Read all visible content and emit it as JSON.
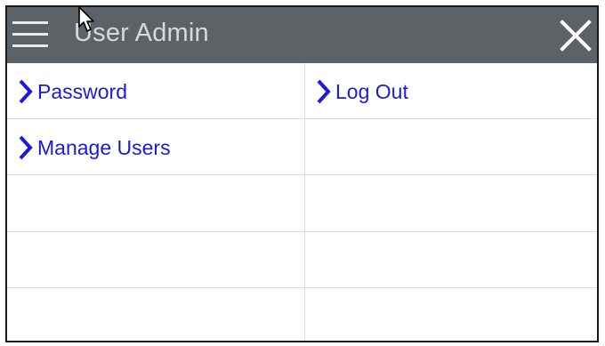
{
  "window": {
    "title": "User Admin"
  },
  "icons": {
    "menu": "hamburger-menu-icon",
    "close": "close-icon",
    "chevron": "chevron-right-icon",
    "cursor": "mouse-pointer-icon"
  },
  "colors": {
    "titlebar_bg": "#5d6266",
    "title_text": "#d7d9da",
    "link": "#1a1adb",
    "chevron": "#1a1adb",
    "grid_line": "#dcdcdc"
  },
  "menu_items": {
    "password": "Password",
    "log_out": "Log Out",
    "manage_users": "Manage Users"
  }
}
